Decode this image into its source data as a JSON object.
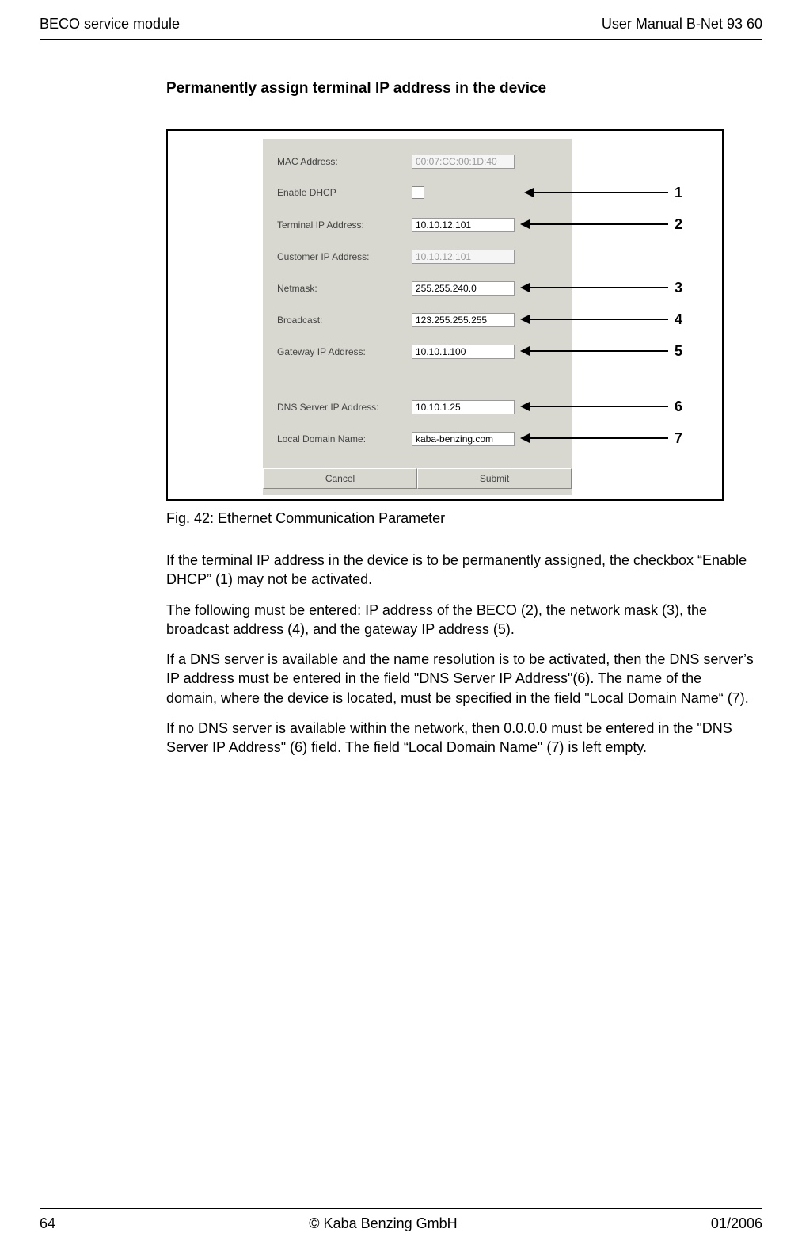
{
  "header": {
    "left": "BECO service module",
    "right": "User Manual B-Net 93 60"
  },
  "section": {
    "title": "Permanently assign terminal IP address in the device"
  },
  "form": {
    "mac_label": "MAC Address:",
    "mac_value": "00:07:CC:00:1D:40",
    "dhcp_label": "Enable DHCP",
    "terminal_ip_label": "Terminal IP Address:",
    "terminal_ip_value": "10.10.12.101",
    "customer_ip_label": "Customer IP Address:",
    "customer_ip_value": "10.10.12.101",
    "netmask_label": "Netmask:",
    "netmask_value": "255.255.240.0",
    "broadcast_label": "Broadcast:",
    "broadcast_value": "123.255.255.255",
    "gateway_label": "Gateway IP Address:",
    "gateway_value": "10.10.1.100",
    "dns_label": "DNS Server IP Address:",
    "dns_value": "10.10.1.25",
    "domain_label": "Local Domain Name:",
    "domain_value": "kaba-benzing.com",
    "cancel": "Cancel",
    "submit": "Submit"
  },
  "callouts": {
    "n1": "1",
    "n2": "2",
    "n3": "3",
    "n4": "4",
    "n5": "5",
    "n6": "6",
    "n7": "7"
  },
  "caption": "Fig. 42: Ethernet Communication Parameter",
  "paragraphs": {
    "p1": "If the terminal IP address in the device is to be permanently assigned, the checkbox “Enable DHCP” (1) may not be activated.",
    "p2": "The following must be entered: IP address of the BECO (2), the network mask (3), the broadcast address (4), and the gateway IP address (5).",
    "p3": "If a DNS server is available and the name resolution is to be activated, then the DNS server’s IP address must be entered in the field \"DNS Server IP Address\"(6). The name of the domain, where the device is located, must be specified in the field \"Local Domain Name“ (7).",
    "p4": "If no DNS server is available within the network, then 0.0.0.0 must be entered in the \"DNS Server IP Address\" (6) field. The field “Local Domain Name\" (7) is left empty."
  },
  "footer": {
    "left": "64",
    "center": "© Kaba Benzing GmbH",
    "right": "01/2006"
  }
}
